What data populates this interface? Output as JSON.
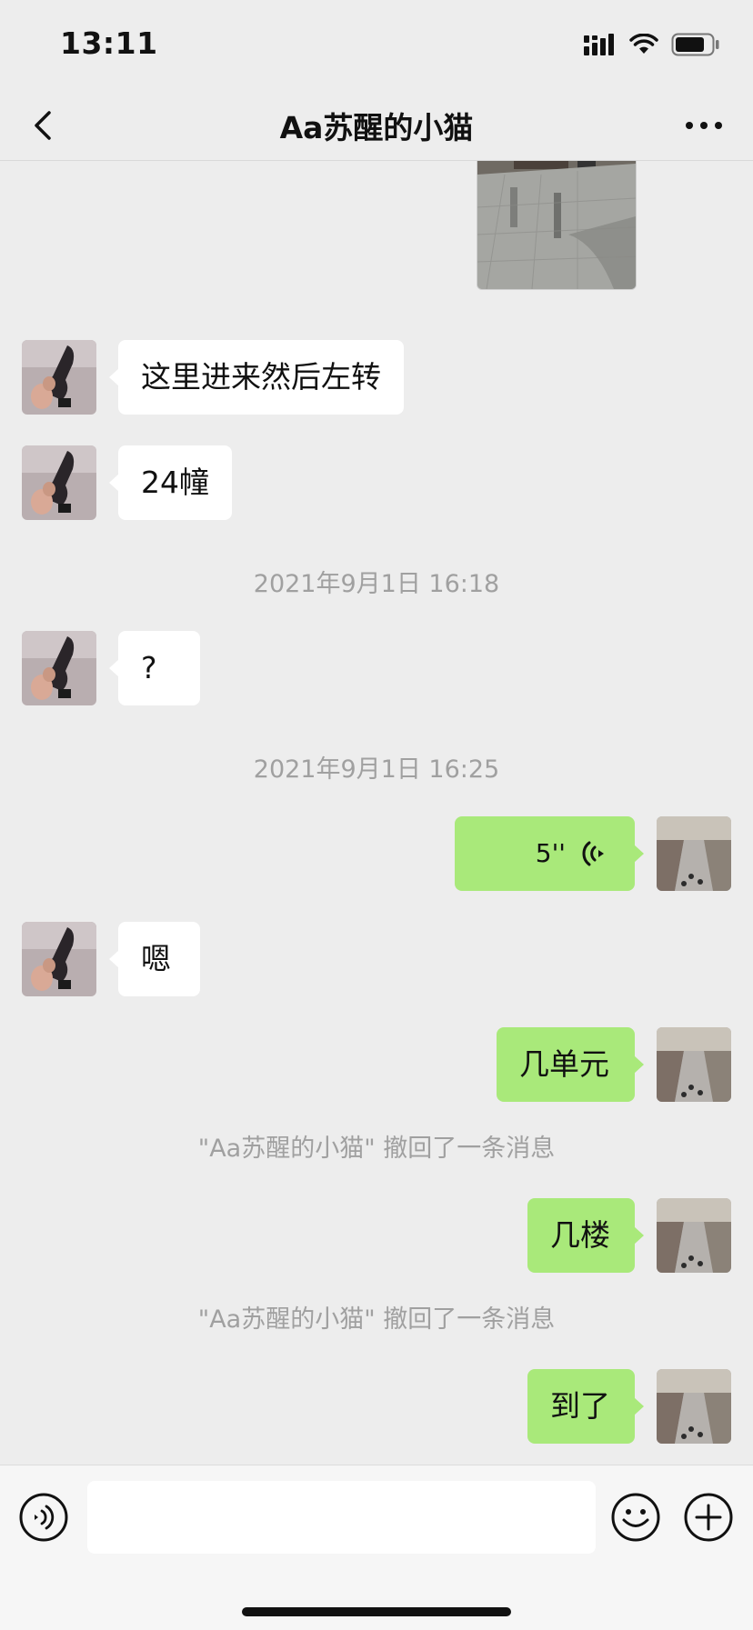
{
  "status_bar": {
    "time": "13:11"
  },
  "header": {
    "title": "Aa苏醒的小猫"
  },
  "messages": [
    {
      "text": "这里进来然后左转"
    },
    {
      "text": "24幢"
    },
    {
      "timestamp": "2021年9月1日 16:18"
    },
    {
      "text": "?"
    },
    {
      "timestamp": "2021年9月1日 16:25"
    },
    {
      "voice_duration": "5''"
    },
    {
      "text": "嗯"
    },
    {
      "text": "几单元"
    },
    {
      "system": "\"Aa苏醒的小猫\" 撤回了一条消息"
    },
    {
      "text": "几楼"
    },
    {
      "system": "\"Aa苏醒的小猫\" 撤回了一条消息"
    },
    {
      "text": "到了"
    }
  ],
  "icons": {
    "back": "chevron-left-icon",
    "more": "more-dots-icon",
    "voice_input": "voice-input-icon",
    "emoji": "emoji-icon",
    "plus": "plus-icon"
  },
  "colors": {
    "background": "#ededed",
    "sent_bubble": "#a9e97a",
    "received_bubble": "#ffffff",
    "meta_text": "#a0a0a0"
  }
}
